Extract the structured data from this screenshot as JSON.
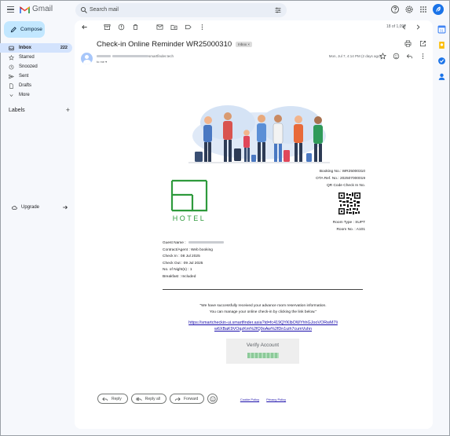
{
  "app": {
    "name": "Gmail"
  },
  "search": {
    "placeholder": "Search mail"
  },
  "compose": {
    "label": "Compose"
  },
  "sidebar": {
    "items": [
      {
        "label": "Inbox",
        "count": "222",
        "icon": "inbox-icon",
        "active": true
      },
      {
        "label": "Starred",
        "icon": "star-icon"
      },
      {
        "label": "Snoozed",
        "icon": "clock-icon"
      },
      {
        "label": "Sent",
        "icon": "send-icon"
      },
      {
        "label": "Drafts",
        "icon": "draft-icon"
      },
      {
        "label": "More",
        "icon": "chevron-down-icon"
      }
    ],
    "labels_title": "Labels",
    "upgrade_label": "Upgrade"
  },
  "toolbar": {
    "pager": "18 of 1,092"
  },
  "email": {
    "subject": "Check-in Online Reminder WR25000310",
    "inbox_chip": "Inbox ×",
    "sender_suffix": "smartfinder.tech",
    "to_line": "to me ▾",
    "date": "Mon, Jul 7, 4:14 PM (2 days ago)"
  },
  "booking": {
    "booking_no": "Booking No.:  WR25000310",
    "ota_ref": "OTA Ref. No.: 202507000019",
    "qr_label": "QR Code Check In No.",
    "room_type": "Room Type : SUPT",
    "room_no": "Room No. : A101"
  },
  "hotel": {
    "logo_text": "HOTEL"
  },
  "guest": {
    "name_label": "Guest Name :",
    "contract": "Contract/Agent : Web booking",
    "check_in": "Check In : 08 Jul 2025",
    "check_out": "Check Out : 09 Jul 2025",
    "nights": "No. of Night(s) : 1",
    "breakfast": "Breakfast : Included"
  },
  "message": {
    "line1": "\"We have successfully received your advance room reservation information.",
    "line2": "You can manage your online check-in by clicking the link below.\"",
    "link1": "https://smartcheckin-ui.smartfinder.asia?id=fc419QYKlbOWYhhGJooVORwM7li",
    "link2": "w6XBaK9VOqzKm%2fQ9oAw%2fDn1uih7cumVuhn",
    "verify_label": "Verify Account"
  },
  "footer": {
    "cookie": "Cookie Policy",
    "privacy": "Privacy Policy"
  },
  "actions": {
    "reply": "Reply",
    "reply_all": "Reply all",
    "forward": "Forward"
  },
  "colors": {
    "accent": "#1a73e8",
    "hotel_green": "#2e9a3c",
    "compose_bg": "#c2e7ff",
    "active_nav": "#d3e3fd"
  }
}
